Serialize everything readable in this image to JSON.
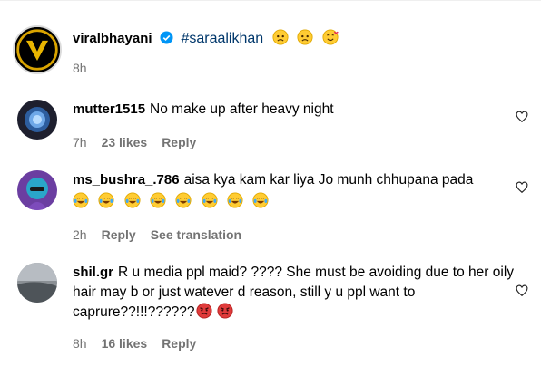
{
  "post": {
    "username": "viralbhayani",
    "hashtag": "#saraalikhan",
    "time": "8h",
    "emojis": [
      "worried-face",
      "worried-face",
      "smiling-face-with-hearts"
    ]
  },
  "comments": [
    {
      "username": "mutter1515",
      "text": "No make up after heavy night",
      "time": "7h",
      "likes": "23 likes",
      "reply": "Reply"
    },
    {
      "username": "ms_bushra_.786",
      "text": "aisa kya kam kar liya Jo munh chhupana pada",
      "emojis": [
        "tears-of-joy",
        "tears-of-joy",
        "tears-of-joy",
        "tears-of-joy",
        "tears-of-joy",
        "tears-of-joy",
        "tears-of-joy",
        "tears-of-joy"
      ],
      "time": "2h",
      "reply": "Reply",
      "see_translation": "See translation"
    },
    {
      "username": "shil.gr",
      "text": "R u media ppl maid? ???? She must be avoiding due to her oily hair may b or just watever d reason, still y u ppl want to caprure??!!!??????",
      "emojis": [
        "angry-face",
        "angry-face"
      ],
      "time": "8h",
      "likes": "16 likes",
      "reply": "Reply"
    }
  ],
  "colors": {
    "link": "#00376b",
    "meta": "#737373",
    "verified": "#0095f6"
  }
}
